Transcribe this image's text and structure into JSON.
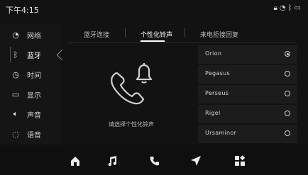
{
  "status_bar": {
    "time": "下午4:15",
    "icons": [
      "lock-icon",
      "wifi-icon",
      "bluetooth-icon",
      "battery-icon"
    ]
  },
  "sidebar": {
    "items": [
      {
        "id": "network",
        "label": "网络",
        "icon": "wifi-icon"
      },
      {
        "id": "bluetooth",
        "label": "蓝牙",
        "icon": "bluetooth-icon",
        "active": true
      },
      {
        "id": "time",
        "label": "时间",
        "icon": "clock-icon"
      },
      {
        "id": "display",
        "label": "显示",
        "icon": "display-icon"
      },
      {
        "id": "sound",
        "label": "声音",
        "icon": "speaker-icon"
      },
      {
        "id": "voice",
        "label": "语音",
        "icon": "voice-icon"
      }
    ]
  },
  "tabs": [
    {
      "label": "蓝牙连接"
    },
    {
      "label": "个性化铃声",
      "active": true
    },
    {
      "label": "来电拒接回复"
    }
  ],
  "main": {
    "empty_text": "请选择个性化铃声"
  },
  "ringtones": [
    {
      "name": "Orion",
      "selected": true
    },
    {
      "name": "Pegasus",
      "selected": false
    },
    {
      "name": "Perseus",
      "selected": false
    },
    {
      "name": "Rigel",
      "selected": false
    },
    {
      "name": "Ursaminor",
      "selected": false
    }
  ],
  "dock": {
    "items": [
      {
        "icon": "home-icon"
      },
      {
        "icon": "music-icon"
      },
      {
        "icon": "phone-icon"
      },
      {
        "icon": "navigation-icon"
      },
      {
        "icon": "apps-icon"
      }
    ]
  }
}
